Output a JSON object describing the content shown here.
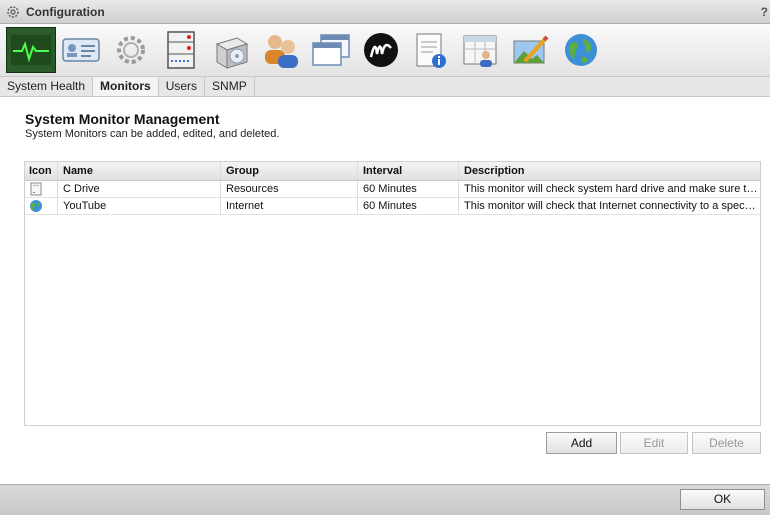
{
  "window": {
    "title": "Configuration",
    "help_label": "?",
    "title_icon": "gear-icon"
  },
  "toolbar": {
    "icons": [
      "system-health-icon",
      "id-card-icon",
      "gear-icon",
      "server-panel-icon",
      "installer-box-icon",
      "users-icon",
      "windows-icon",
      "brand-logo-icon",
      "notepad-info-icon",
      "calendar-user-icon",
      "landscape-pencil-icon",
      "globe-icon"
    ]
  },
  "tabs": [
    "System Health",
    "Monitors",
    "Users",
    "SNMP"
  ],
  "active_tab": "Monitors",
  "content": {
    "title": "System Monitor Management",
    "subtitle": "System Monitors can be added, edited, and deleted."
  },
  "table": {
    "columns": [
      "Icon",
      "Name",
      "Group",
      "Interval",
      "Description"
    ],
    "rows": [
      {
        "icon": "drive-icon",
        "name": "C Drive",
        "group": "Resources",
        "interval": "60 Minutes",
        "description": "This monitor will check system hard drive and make sure the usage..."
      },
      {
        "icon": "globe-icon",
        "name": "YouTube",
        "group": "Internet",
        "interval": "60 Minutes",
        "description": "This monitor will check that Internet connectivity to a specified URL..."
      }
    ]
  },
  "actions": {
    "add_label": "Add",
    "edit_label": "Edit",
    "delete_label": "Delete"
  },
  "footer": {
    "ok_label": "OK"
  },
  "colors": {
    "active_tool_bg": "#2b5a2b",
    "pulse_line": "#4cff4c"
  }
}
